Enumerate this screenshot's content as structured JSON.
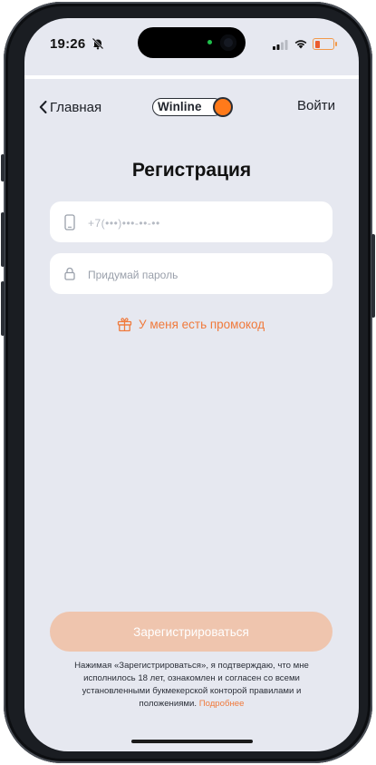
{
  "status": {
    "time": "19:26"
  },
  "nav": {
    "back_label": "Главная",
    "logo_text": "Winline",
    "login_label": "Войти"
  },
  "page": {
    "title": "Регистрация"
  },
  "form": {
    "phone_placeholder": "+7(•••)•••-••-••",
    "password_placeholder": "Придумай пароль",
    "promo_label": "У меня есть промокод",
    "submit_label": "Зарегистрироваться"
  },
  "legal": {
    "text": "Нажимая «Зарегистрироваться», я подтверждаю, что мне исполнилось 18 лет, ознакомлен и согласен со всеми установленными букмекерской конторой правилами и положениями.",
    "link": "Подробнее"
  },
  "colors": {
    "accent": "#f07a3c",
    "button_disabled": "#efc5ae",
    "background": "#e6e8f0",
    "logo_ball": "#ff7a1a"
  },
  "icons": {
    "bell": "bell-slash-icon",
    "signal": "cellular-signal-icon",
    "wifi": "wifi-icon",
    "battery": "battery-low-icon",
    "back": "chevron-left-icon",
    "phone": "smartphone-icon",
    "lock": "lock-icon",
    "promo": "gift-icon"
  }
}
